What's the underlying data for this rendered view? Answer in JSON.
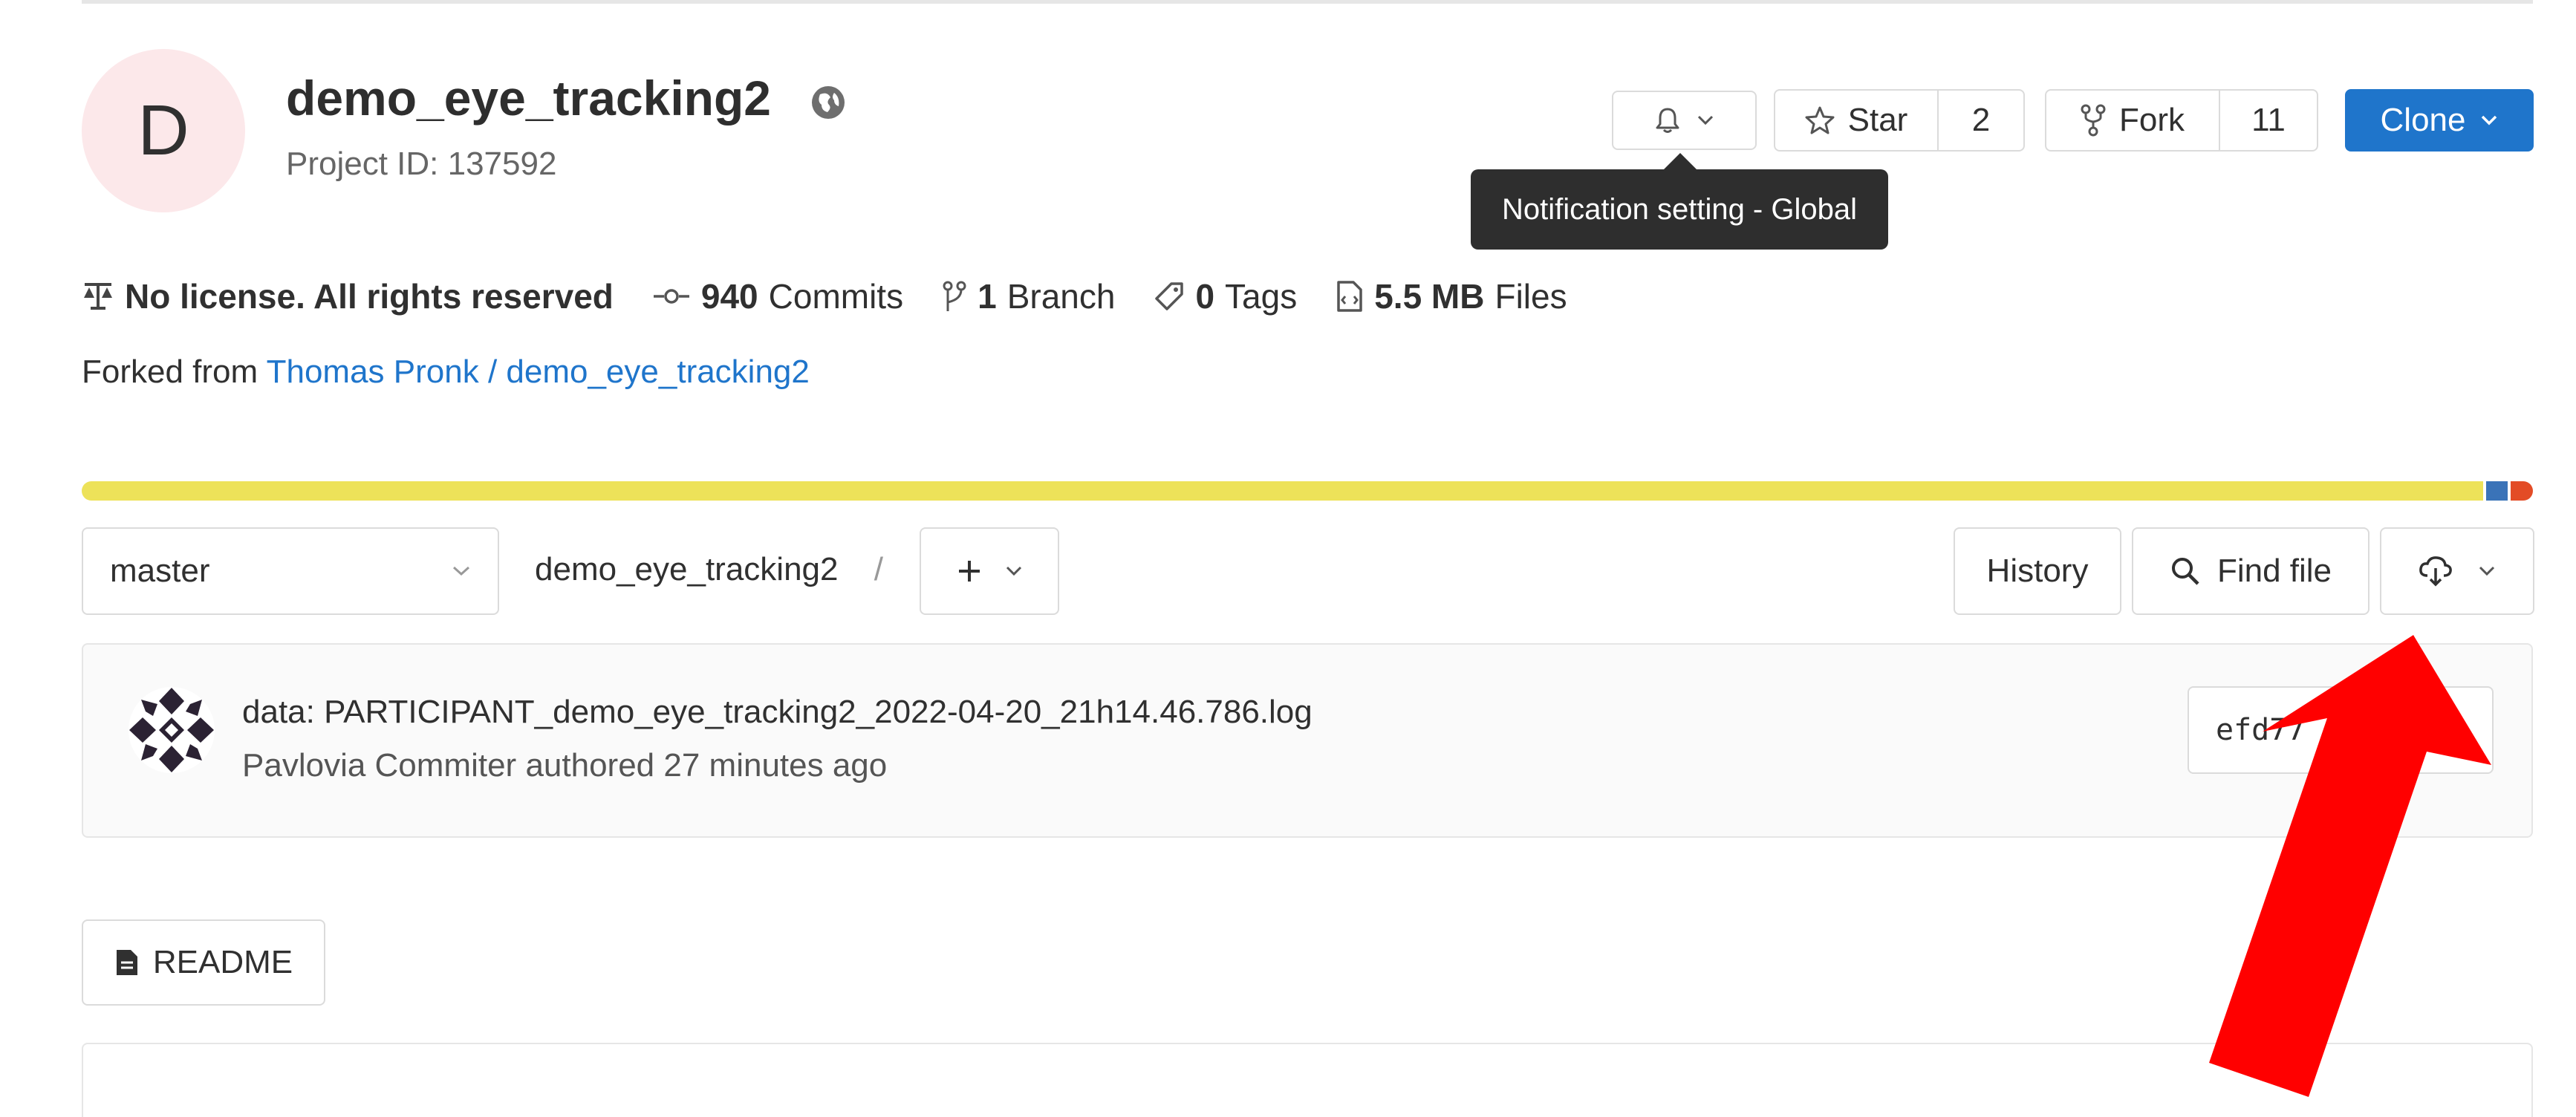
{
  "project": {
    "avatar_letter": "D",
    "name": "demo_eye_tracking2",
    "id_text": "Project ID: 137592",
    "visibility_icon": "globe-icon"
  },
  "actions": {
    "notification_icon": "bell-icon",
    "star_label": "Star",
    "star_count": "2",
    "fork_label": "Fork",
    "fork_count": "11",
    "clone_label": "Clone"
  },
  "tooltip": {
    "text": "Notification setting - Global"
  },
  "stats": {
    "license": "No license. All rights reserved",
    "commits_count": "940",
    "commits_label": "Commits",
    "branches_count": "1",
    "branches_label": "Branch",
    "tags_count": "0",
    "tags_label": "Tags",
    "files_size": "5.5 MB",
    "files_label": "Files"
  },
  "fork_info": {
    "prefix": "Forked from",
    "source": "Thomas Pronk / demo_eye_tracking2"
  },
  "language_bar": [
    {
      "share": 98.2,
      "color": "#ede259"
    },
    {
      "share": 0.9,
      "color": "#3a73b8"
    },
    {
      "share": 0.9,
      "color": "#e34c26"
    }
  ],
  "repo_nav": {
    "branch": "master",
    "path_root": "demo_eye_tracking2",
    "path_separator": "/",
    "history_label": "History",
    "find_file_label": "Find file"
  },
  "last_commit": {
    "title": "data: PARTICIPANT_demo_eye_tracking2_2022-04-20_21h14.46.786.log",
    "author": "Pavlovia Commiter",
    "meta_suffix": "authored 27 minutes ago",
    "sha": "efd77"
  },
  "readme": {
    "label": "README"
  },
  "colors": {
    "accent": "#1f75cb",
    "tooltip_bg": "#2e2e2e",
    "annotation_arrow": "#ff0000"
  }
}
